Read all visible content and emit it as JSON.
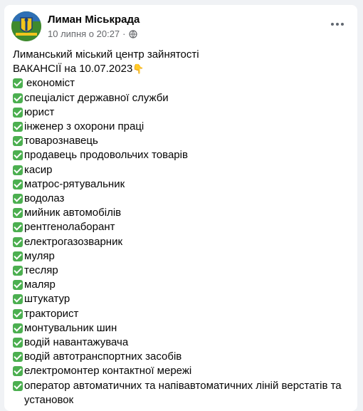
{
  "post": {
    "page_name": "Лиман Міськрада",
    "timestamp": "10 липня о 20:27",
    "separator": "·",
    "audience_icon": "globe-icon",
    "more_icon": "more-options-icon",
    "intro_line": "Лиманський міський центр зайнятості",
    "headline": "ВАКАНСІЇ на 10.07.2023",
    "headline_emoji": "👇",
    "vacancies": [
      "економіст",
      "спеціаліст державної служби",
      "юрист",
      "інженер з охорони праці",
      "товарознавець",
      "продавець продовольчих товарів",
      "касир",
      "матрос-рятувальник",
      "водолаз",
      "мийник автомобілів",
      "рентгенолаборант",
      "електрогазозварник",
      "муляр",
      "тесляр",
      "маляр",
      "штукатур",
      "тракторист",
      "монтувальник шин",
      "водій навантажувача",
      "водій автотранспортних засобів",
      "електромонтер контактної мережі",
      "оператор автоматичних та напівавтоматичних ліній верстатів та установок"
    ]
  },
  "colors": {
    "page_background": "#f0f2f5",
    "card_background": "#ffffff",
    "check_green": "#4caf50",
    "secondary_text": "#65676b"
  }
}
